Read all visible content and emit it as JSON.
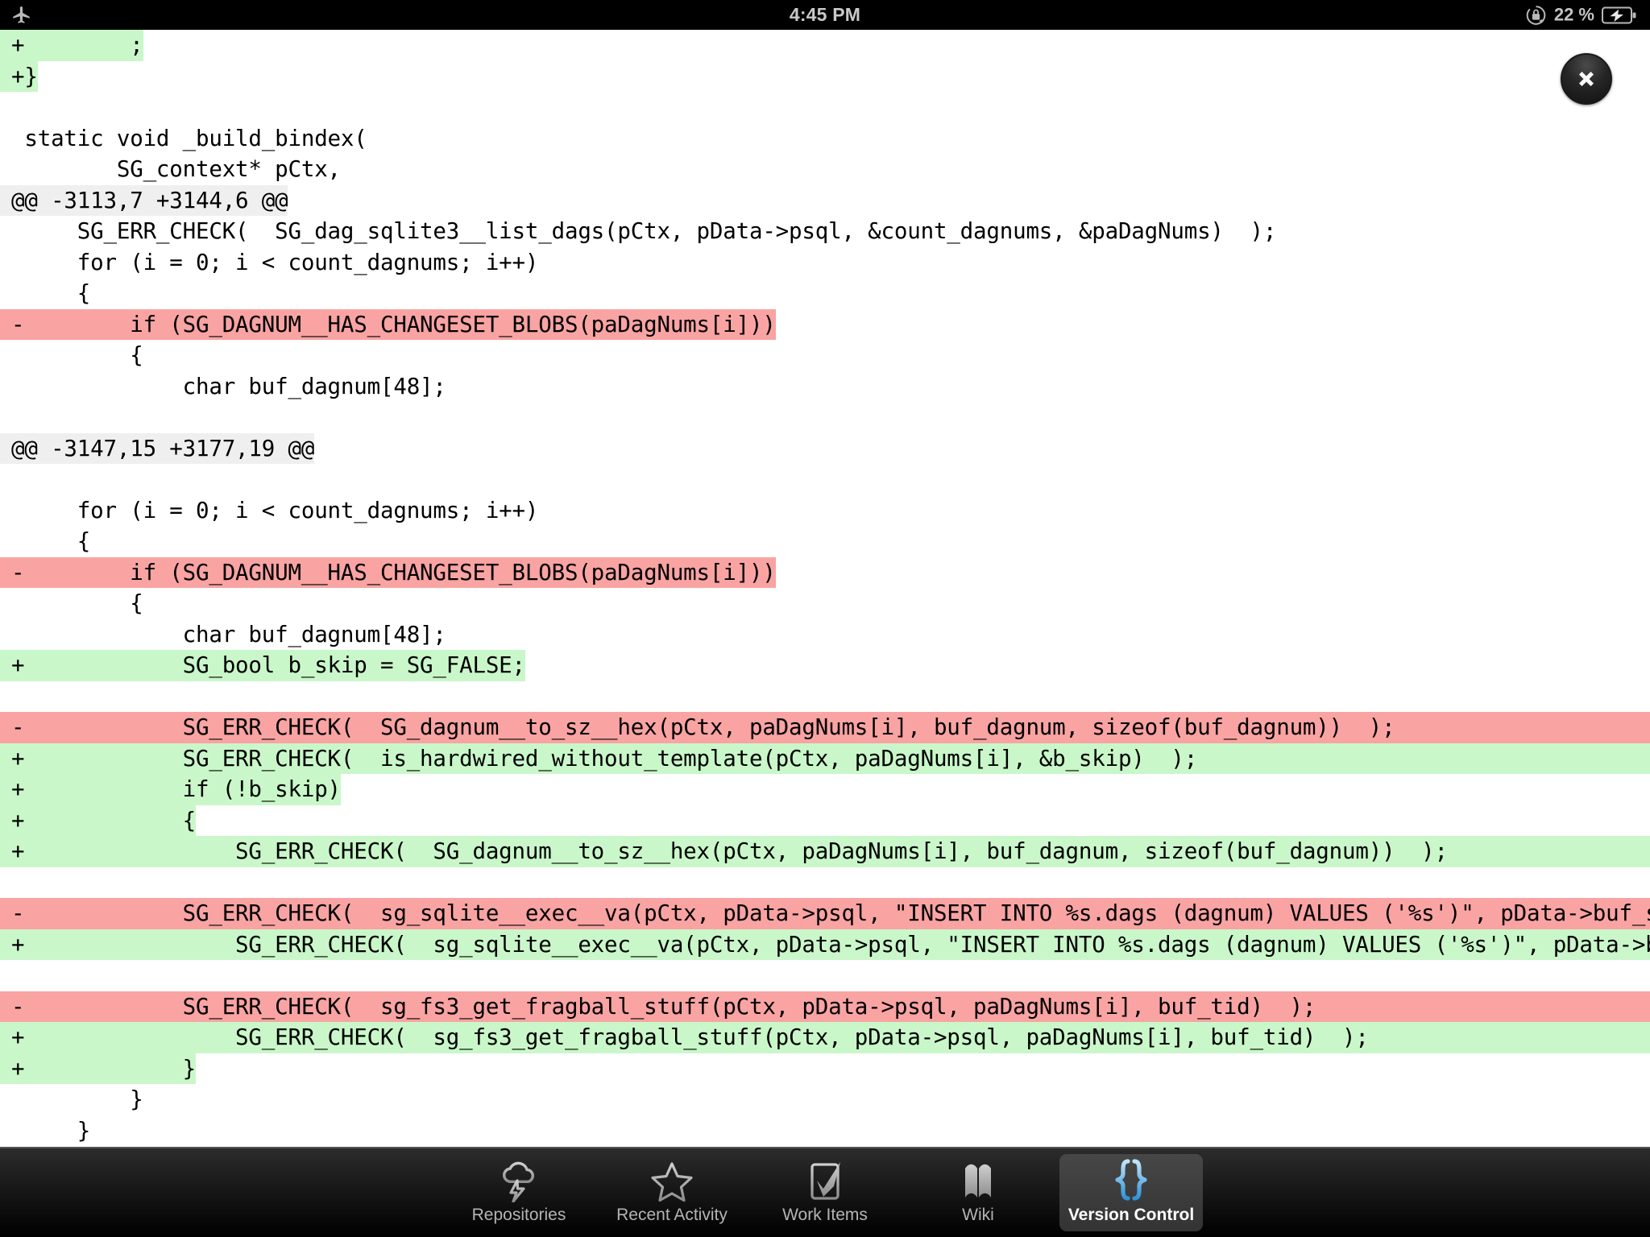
{
  "status_bar": {
    "airplane_icon": "airplane-icon",
    "time": "4:45 PM",
    "rotation_lock_icon": "rotation-lock-icon",
    "battery_percent": "22 %",
    "battery_icon": "battery-charging-icon"
  },
  "close_button": {
    "label": "close-icon"
  },
  "diff": {
    "lines": [
      {
        "type": "add",
        "text": "+        ;"
      },
      {
        "type": "add",
        "text": "+}"
      },
      {
        "type": "blank",
        "text": ""
      },
      {
        "type": "ctx",
        "text": " static void _build_bindex("
      },
      {
        "type": "ctx",
        "text": "        SG_context* pCtx,"
      },
      {
        "type": "hunk",
        "text": "@@ -3113,7 +3144,6 @@"
      },
      {
        "type": "ctx",
        "text": "     SG_ERR_CHECK(  SG_dag_sqlite3__list_dags(pCtx, pData->psql, &count_dagnums, &paDagNums)  );"
      },
      {
        "type": "ctx",
        "text": "     for (i = 0; i < count_dagnums; i++)"
      },
      {
        "type": "ctx",
        "text": "     {"
      },
      {
        "type": "del",
        "text": "-        if (SG_DAGNUM__HAS_CHANGESET_BLOBS(paDagNums[i]))"
      },
      {
        "type": "ctx",
        "text": "         {"
      },
      {
        "type": "ctx",
        "text": "             char buf_dagnum[48];"
      },
      {
        "type": "blank",
        "text": ""
      },
      {
        "type": "hunk",
        "text": "@@ -3147,15 +3177,19 @@"
      },
      {
        "type": "blank",
        "text": ""
      },
      {
        "type": "ctx",
        "text": "     for (i = 0; i < count_dagnums; i++)"
      },
      {
        "type": "ctx",
        "text": "     {"
      },
      {
        "type": "del",
        "text": "-        if (SG_DAGNUM__HAS_CHANGESET_BLOBS(paDagNums[i]))"
      },
      {
        "type": "ctx",
        "text": "         {"
      },
      {
        "type": "ctx",
        "text": "             char buf_dagnum[48];"
      },
      {
        "type": "add",
        "text": "+            SG_bool b_skip = SG_FALSE;"
      },
      {
        "type": "blank",
        "text": ""
      },
      {
        "type": "del",
        "text": "-            SG_ERR_CHECK(  SG_dagnum__to_sz__hex(pCtx, paDagNums[i], buf_dagnum, sizeof(buf_dagnum))  );"
      },
      {
        "type": "add",
        "text": "+            SG_ERR_CHECK(  is_hardwired_without_template(pCtx, paDagNums[i], &b_skip)  );"
      },
      {
        "type": "add",
        "text": "+            if (!b_skip)"
      },
      {
        "type": "add",
        "text": "+            {"
      },
      {
        "type": "add",
        "text": "+                SG_ERR_CHECK(  SG_dagnum__to_sz__hex(pCtx, paDagNums[i], buf_dagnum, sizeof(buf_dagnum))  );"
      },
      {
        "type": "blank",
        "text": ""
      },
      {
        "type": "del",
        "text": "-            SG_ERR_CHECK(  sg_sqlite__exec__va(pCtx, pData->psql, \"INSERT INTO %s.dags (dagnum) VALUES ('%s')\", pData->buf_storage_name, buf_dagnum)  );"
      },
      {
        "type": "add",
        "text": "+                SG_ERR_CHECK(  sg_sqlite__exec__va(pCtx, pData->psql, \"INSERT INTO %s.dags (dagnum) VALUES ('%s')\", pData->buf_storage_name, buf_dagnum)  );"
      },
      {
        "type": "blank",
        "text": ""
      },
      {
        "type": "del",
        "text": "-            SG_ERR_CHECK(  sg_fs3_get_fragball_stuff(pCtx, pData->psql, paDagNums[i], buf_tid)  );"
      },
      {
        "type": "add",
        "text": "+                SG_ERR_CHECK(  sg_fs3_get_fragball_stuff(pCtx, pData->psql, paDagNums[i], buf_tid)  );"
      },
      {
        "type": "add",
        "text": "+            }"
      },
      {
        "type": "ctx",
        "text": "         }"
      },
      {
        "type": "ctx",
        "text": "     }"
      }
    ]
  },
  "tabbar": {
    "tabs": [
      {
        "label": "Repositories",
        "icon": "cloud-lightning-icon",
        "selected": false
      },
      {
        "label": "Recent Activity",
        "icon": "star-icon",
        "selected": false
      },
      {
        "label": "Work Items",
        "icon": "checkbox-icon",
        "selected": false
      },
      {
        "label": "Wiki",
        "icon": "open-book-icon",
        "selected": false
      },
      {
        "label": "Version Control",
        "icon": "braces-icon",
        "selected": true
      }
    ]
  },
  "colors": {
    "added_bg": "#c9f7c9",
    "removed_bg": "#f9a3a3",
    "hunk_bg": "#efefef",
    "accent": "#4aa8e0",
    "status_bar_bg": "#000000",
    "page_bg": "#ffffff"
  }
}
